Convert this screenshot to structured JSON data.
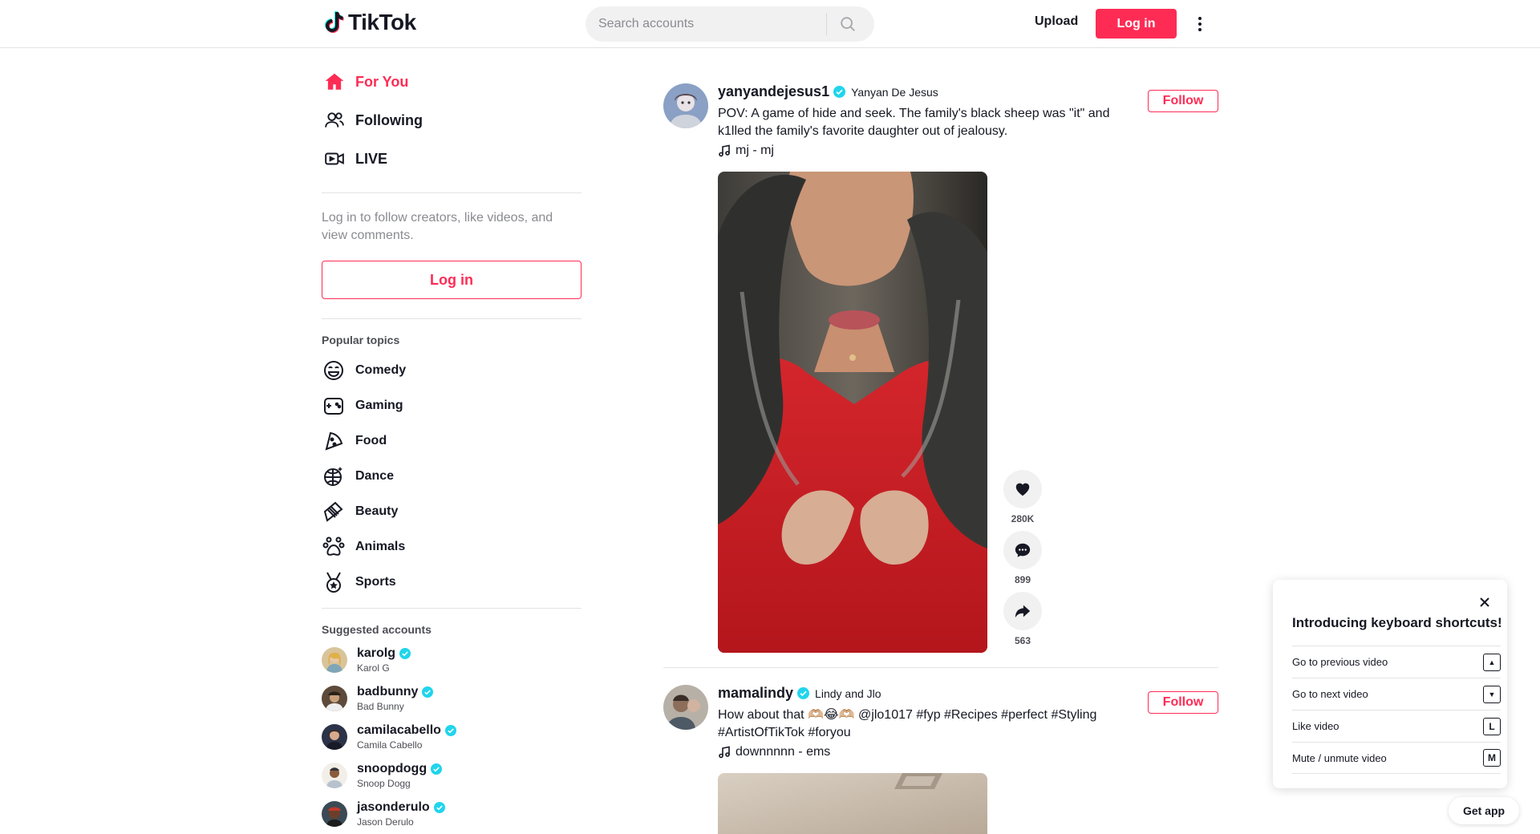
{
  "header": {
    "logo_text": "TikTok",
    "search_placeholder": "Search accounts",
    "upload_label": "Upload",
    "login_label": "Log in"
  },
  "sidebar": {
    "nav": [
      {
        "label": "For You",
        "icon": "home-icon"
      },
      {
        "label": "Following",
        "icon": "users-icon"
      },
      {
        "label": "LIVE",
        "icon": "live-icon"
      }
    ],
    "login_hint": "Log in to follow creators, like videos, and view comments.",
    "login_label": "Log in",
    "popular_topics_title": "Popular topics",
    "topics": [
      {
        "label": "Comedy",
        "icon": "comedy-icon"
      },
      {
        "label": "Gaming",
        "icon": "gaming-icon"
      },
      {
        "label": "Food",
        "icon": "food-icon"
      },
      {
        "label": "Dance",
        "icon": "dance-icon"
      },
      {
        "label": "Beauty",
        "icon": "beauty-icon"
      },
      {
        "label": "Animals",
        "icon": "animals-icon"
      },
      {
        "label": "Sports",
        "icon": "sports-icon"
      }
    ],
    "suggested_title": "Suggested accounts",
    "accounts": [
      {
        "username": "karolg",
        "nickname": "Karol G"
      },
      {
        "username": "badbunny",
        "nickname": "Bad Bunny"
      },
      {
        "username": "camilacabello",
        "nickname": "Camila Cabello"
      },
      {
        "username": "snoopdogg",
        "nickname": "Snoop Dogg"
      },
      {
        "username": "jasonderulo",
        "nickname": "Jason Derulo"
      }
    ]
  },
  "feed": [
    {
      "username": "yanyandejesus1",
      "nickname": "Yanyan De Jesus",
      "description": "POV: A game of hide and seek. The family's black sheep was \"it\" and k1lled the family's favorite daughter out of jealousy.",
      "music": "mj - mj",
      "follow_label": "Follow",
      "likes": "280K",
      "comments": "899",
      "shares": "563"
    },
    {
      "username": "mamalindy",
      "nickname": "Lindy and Jlo",
      "description": "How about that 🫶🏼😂🫶🏼 @jlo1017 #fyp #Recipes #perfect #Styling #ArtistOfTikTok #foryou",
      "music": "downnnnn - ems",
      "follow_label": "Follow"
    }
  ],
  "keyboard_popup": {
    "title": "Introducing keyboard shortcuts!",
    "shortcuts": [
      {
        "label": "Go to previous video",
        "key": "▲"
      },
      {
        "label": "Go to next video",
        "key": "▼"
      },
      {
        "label": "Like video",
        "key": "L"
      },
      {
        "label": "Mute / unmute video",
        "key": "M"
      }
    ]
  },
  "get_app_label": "Get app",
  "colors": {
    "accent": "#fe2c55",
    "verified": "#20d5ec"
  }
}
